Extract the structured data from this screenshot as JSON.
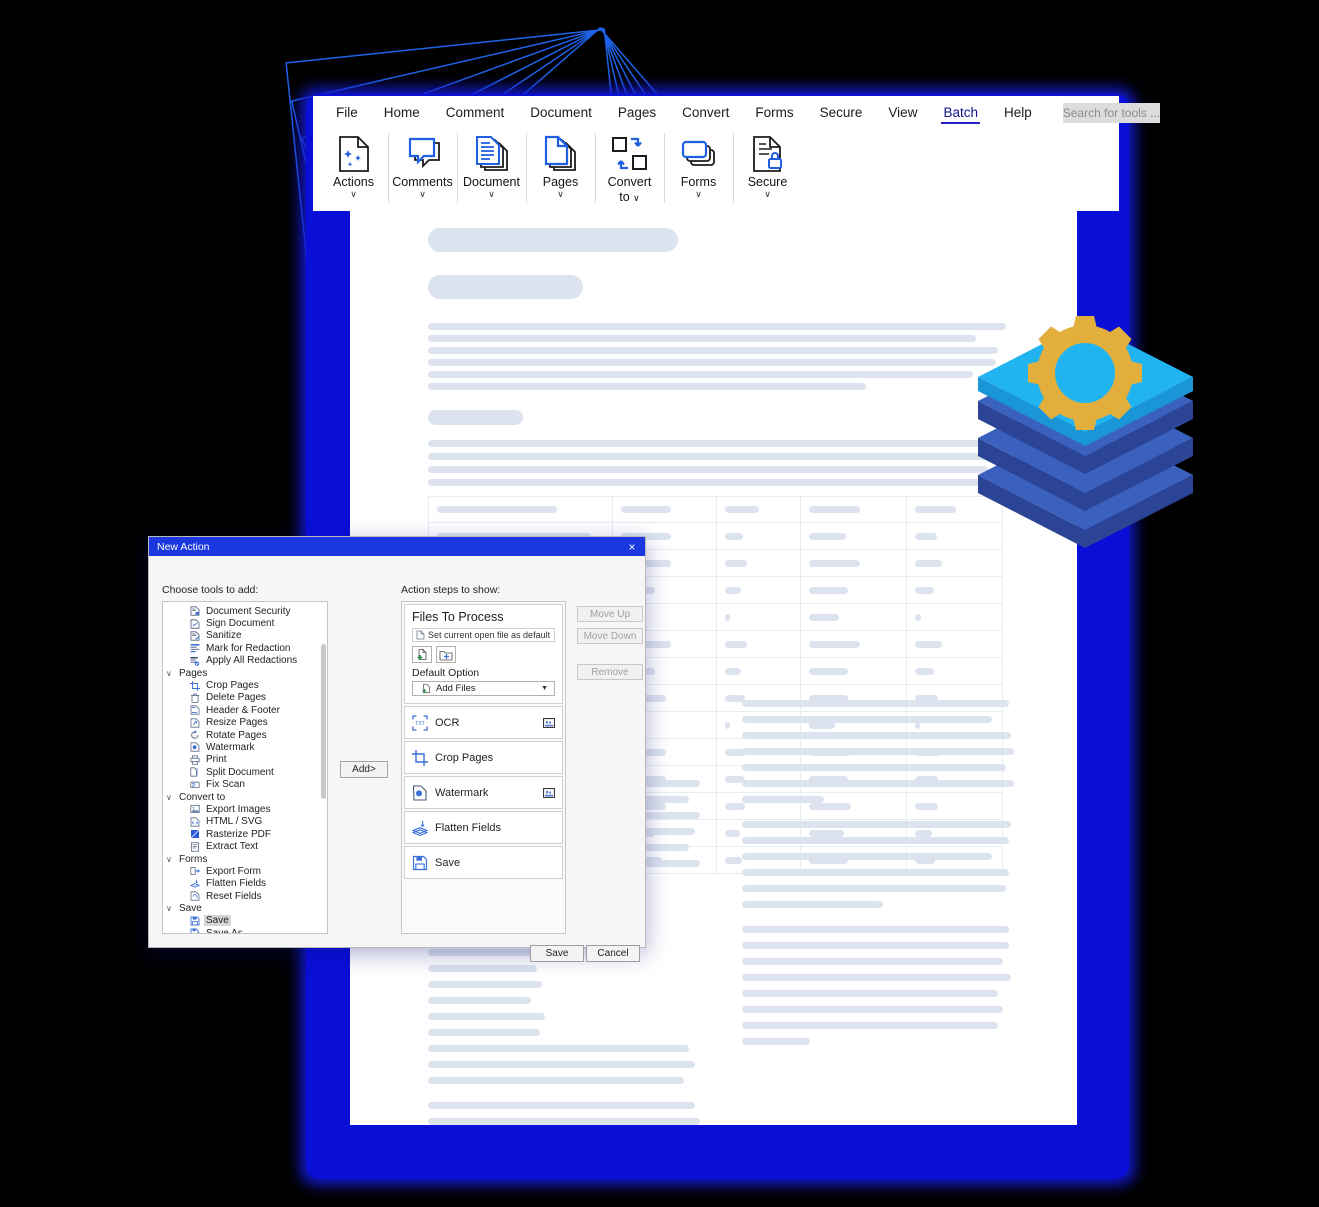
{
  "app": {
    "menu": [
      {
        "label": "File",
        "active": false
      },
      {
        "label": "Home",
        "active": false
      },
      {
        "label": "Comment",
        "active": false
      },
      {
        "label": "Document",
        "active": false
      },
      {
        "label": "Pages",
        "active": false
      },
      {
        "label": "Convert",
        "active": false
      },
      {
        "label": "Forms",
        "active": false
      },
      {
        "label": "Secure",
        "active": false
      },
      {
        "label": "View",
        "active": false
      },
      {
        "label": "Batch",
        "active": true
      },
      {
        "label": "Help",
        "active": false
      }
    ],
    "search_placeholder": "Search for tools ...",
    "ribbon": [
      {
        "label": "Actions",
        "icon": "actions-sparkle-page-icon",
        "caret": "∨"
      },
      {
        "label": "Comments",
        "icon": "comment-bubbles-icon",
        "caret": "∨"
      },
      {
        "label": "Document",
        "icon": "document-stack-icon",
        "caret": "∨"
      },
      {
        "label": "Pages",
        "icon": "pages-stack-icon",
        "caret": "∨"
      },
      {
        "label": "Convert",
        "label2": "to",
        "icon": "convert-arrows-icon",
        "caret": "∨"
      },
      {
        "label": "Forms",
        "icon": "forms-stack-icon",
        "caret": "∨"
      },
      {
        "label": "Secure",
        "icon": "secure-lock-page-icon",
        "caret": "∨"
      }
    ],
    "accent_color": "#2323c8",
    "titlebar_color": "#1a37e0"
  },
  "dialog": {
    "title": "New Action",
    "close_glyph": "×",
    "left_label": "Choose tools to add:",
    "right_label": "Action steps to show:",
    "add_button": "Add>",
    "tree": [
      {
        "type": "leaf",
        "label": "Document Security",
        "icon": "document-security-icon"
      },
      {
        "type": "leaf",
        "label": "Sign Document",
        "icon": "sign-document-icon"
      },
      {
        "type": "leaf",
        "label": "Sanitize",
        "icon": "sanitize-icon"
      },
      {
        "type": "leaf",
        "label": "Mark for Redaction",
        "icon": "mark-redaction-icon"
      },
      {
        "type": "leaf",
        "label": "Apply All Redactions",
        "icon": "apply-redactions-icon"
      },
      {
        "type": "group",
        "label": "Pages",
        "chevron": "∨"
      },
      {
        "type": "leaf",
        "label": "Crop Pages",
        "icon": "crop-pages-icon"
      },
      {
        "type": "leaf",
        "label": "Delete Pages",
        "icon": "delete-pages-icon"
      },
      {
        "type": "leaf",
        "label": "Header & Footer",
        "icon": "header-footer-icon"
      },
      {
        "type": "leaf",
        "label": "Resize Pages",
        "icon": "resize-pages-icon"
      },
      {
        "type": "leaf",
        "label": "Rotate Pages",
        "icon": "rotate-pages-icon"
      },
      {
        "type": "leaf",
        "label": "Watermark",
        "icon": "watermark-icon"
      },
      {
        "type": "leaf",
        "label": "Print",
        "icon": "print-icon"
      },
      {
        "type": "leaf",
        "label": "Split Document",
        "icon": "split-document-icon"
      },
      {
        "type": "leaf",
        "label": "Fix Scan",
        "icon": "fix-scan-icon"
      },
      {
        "type": "group",
        "label": "Convert to",
        "chevron": "∨"
      },
      {
        "type": "leaf",
        "label": "Export Images",
        "icon": "export-images-icon"
      },
      {
        "type": "leaf",
        "label": "HTML / SVG",
        "icon": "html-svg-icon"
      },
      {
        "type": "leaf",
        "label": "Rasterize PDF",
        "icon": "rasterize-pdf-icon"
      },
      {
        "type": "leaf",
        "label": "Extract Text",
        "icon": "extract-text-icon"
      },
      {
        "type": "group",
        "label": "Forms",
        "chevron": "∨"
      },
      {
        "type": "leaf",
        "label": "Export Form",
        "icon": "export-form-icon"
      },
      {
        "type": "leaf",
        "label": "Flatten Fields",
        "icon": "flatten-fields-icon"
      },
      {
        "type": "leaf",
        "label": "Reset Fields",
        "icon": "reset-fields-icon"
      },
      {
        "type": "group",
        "label": "Save",
        "chevron": "∨"
      },
      {
        "type": "leaf",
        "label": "Save",
        "icon": "save-icon",
        "selected": true
      },
      {
        "type": "leaf",
        "label": "Save As...",
        "icon": "save-as-icon"
      }
    ],
    "files_step": {
      "title": "Files To Process",
      "default_file_label": "Set current open file as default",
      "add_file_icon": "add-file-icon",
      "add_folder_icon": "add-folder-icon",
      "default_option_label": "Default Option",
      "default_option_value": "Add Files",
      "default_option_arrow": "▼"
    },
    "steps": [
      {
        "label": "OCR",
        "icon": "ocr-icon",
        "badge": "settings-badge-icon"
      },
      {
        "label": "Crop Pages",
        "icon": "crop-pages-icon",
        "badge": null
      },
      {
        "label": "Watermark",
        "icon": "watermark-icon",
        "badge": "settings-badge-icon"
      },
      {
        "label": "Flatten Fields",
        "icon": "flatten-fields-icon",
        "badge": null
      },
      {
        "label": "Save",
        "icon": "save-icon",
        "badge": null
      }
    ],
    "side_buttons": [
      {
        "label": "Move Up",
        "name": "move-up-button"
      },
      {
        "label": "Move Down",
        "name": "move-down-button"
      },
      {
        "label": "Remove",
        "name": "remove-button"
      }
    ],
    "footer_buttons": [
      {
        "label": "Save",
        "name": "dialog-save-button"
      },
      {
        "label": "Cancel",
        "name": "dialog-cancel-button"
      }
    ]
  },
  "graphic": {
    "name": "batch-layers-gear-graphic",
    "top_layer_color": "#22b4f0",
    "gear_color": "#e2ae3c",
    "layer_dark_color": "#2b4496",
    "layer_mid_color": "#3a61bd"
  },
  "document": {
    "skeleton_name": "document-skeleton-preview",
    "placeholder_color": "#dde3ee",
    "table_columns": 5,
    "table_rows": 14
  },
  "background": {
    "fan_pages_count": 6,
    "fan_outline_color": "#1f5fe0",
    "glow_color": "#0a0fd8"
  }
}
